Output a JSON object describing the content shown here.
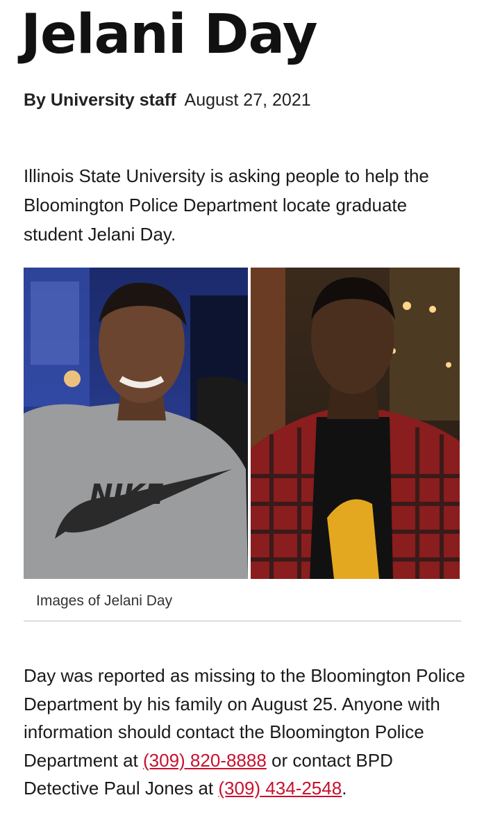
{
  "article": {
    "title": "Jelani Day",
    "author": "By University staff",
    "date": "August 27, 2021",
    "lede": "Illinois State University is asking people to help the Bloomington Police Department locate graduate student Jelani Day.",
    "image_caption": "Images of Jelani Day",
    "shirt_text": "NIKE",
    "body": {
      "part1": "Day was reported as missing to the Bloomington Police Department by his family on August 25. Anyone with information should contact the Bloomington Police Department at ",
      "phone1": "(309) 820-8888",
      "part2": " or contact BPD Detective Paul Jones at ",
      "phone2": "(309) 434-2548",
      "part3": "."
    }
  },
  "colors": {
    "link": "#c8102e",
    "text": "#1a1a1a",
    "rule": "#bdbdbd"
  }
}
